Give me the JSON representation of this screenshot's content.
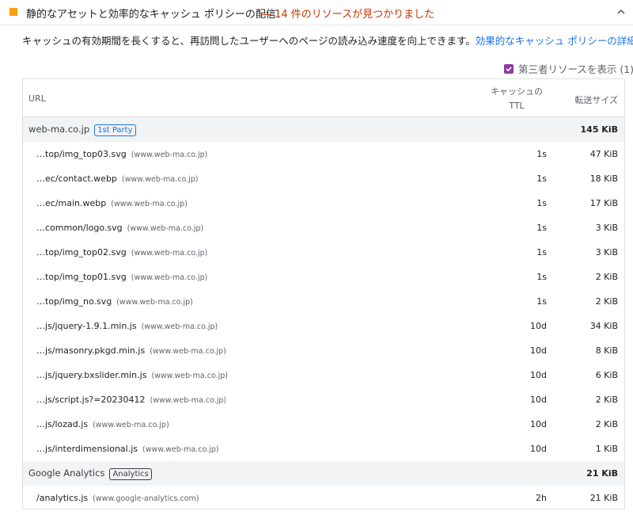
{
  "audit": {
    "title": "静的なアセットと効率的なキャッシュ ポリシーの配信",
    "summary": "— 14 件のリソースが見つかりました",
    "status_color": "#fa9e0f",
    "description": "キャッシュの有効期間を長くすると、再訪問したユーザーへのページの読み込み速度を向上できます。",
    "learn_more_link": "効果的なキャッシュ ポリシーの詳細",
    "third_party_toggle": "第三者リソースを表示 (1)"
  },
  "table": {
    "headers": {
      "url": "URL",
      "ttl_line1": "キャッシュの",
      "ttl_line2": "TTL",
      "size": "転送サイズ"
    },
    "groups": [
      {
        "name": "web-ma.co.jp",
        "badge": "1st Party",
        "total": "145 KiB",
        "items": [
          {
            "url": "…top/img_top03.svg",
            "host": "(www.web-ma.co.jp)",
            "ttl": "1s",
            "size": "47 KiB"
          },
          {
            "url": "…ec/contact.webp",
            "host": "(www.web-ma.co.jp)",
            "ttl": "1s",
            "size": "18 KiB"
          },
          {
            "url": "…ec/main.webp",
            "host": "(www.web-ma.co.jp)",
            "ttl": "1s",
            "size": "17 KiB"
          },
          {
            "url": "…common/logo.svg",
            "host": "(www.web-ma.co.jp)",
            "ttl": "1s",
            "size": "3 KiB"
          },
          {
            "url": "…top/img_top02.svg",
            "host": "(www.web-ma.co.jp)",
            "ttl": "1s",
            "size": "3 KiB"
          },
          {
            "url": "…top/img_top01.svg",
            "host": "(www.web-ma.co.jp)",
            "ttl": "1s",
            "size": "2 KiB"
          },
          {
            "url": "…top/img_no.svg",
            "host": "(www.web-ma.co.jp)",
            "ttl": "1s",
            "size": "2 KiB"
          },
          {
            "url": "…js/jquery-1.9.1.min.js",
            "host": "(www.web-ma.co.jp)",
            "ttl": "10d",
            "size": "34 KiB"
          },
          {
            "url": "…js/masonry.pkgd.min.js",
            "host": "(www.web-ma.co.jp)",
            "ttl": "10d",
            "size": "8 KiB"
          },
          {
            "url": "…js/jquery.bxslider.min.js",
            "host": "(www.web-ma.co.jp)",
            "ttl": "10d",
            "size": "6 KiB"
          },
          {
            "url": "…js/script.js?=20230412",
            "host": "(www.web-ma.co.jp)",
            "ttl": "10d",
            "size": "2 KiB"
          },
          {
            "url": "…js/lozad.js",
            "host": "(www.web-ma.co.jp)",
            "ttl": "10d",
            "size": "2 KiB"
          },
          {
            "url": "…js/interdimensional.js",
            "host": "(www.web-ma.co.jp)",
            "ttl": "10d",
            "size": "1 KiB"
          }
        ]
      },
      {
        "name": "Google Analytics",
        "badge": "Analytics",
        "total": "21 KiB",
        "items": [
          {
            "url": "/analytics.js",
            "host": "(www.google-analytics.com)",
            "ttl": "2h",
            "size": "21 KiB"
          }
        ]
      }
    ]
  }
}
